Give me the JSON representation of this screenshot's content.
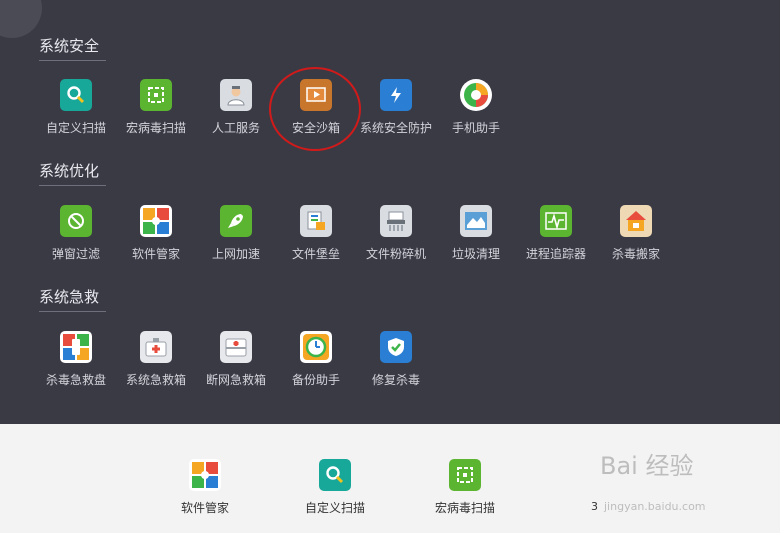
{
  "sections": {
    "security": {
      "title": "系统安全",
      "items": [
        "自定义扫描",
        "宏病毒扫描",
        "人工服务",
        "安全沙箱",
        "系统安全防护",
        "手机助手"
      ]
    },
    "optimize": {
      "title": "系统优化",
      "items": [
        "弹窗过滤",
        "软件管家",
        "上网加速",
        "文件堡垒",
        "文件粉碎机",
        "垃圾清理",
        "进程追踪器",
        "杀毒搬家"
      ]
    },
    "rescue": {
      "title": "系统急救",
      "items": [
        "杀毒急救盘",
        "系统急救箱",
        "断网急救箱",
        "备份助手",
        "修复杀毒"
      ]
    }
  },
  "pinned": [
    "软件管家",
    "自定义扫描",
    "宏病毒扫描"
  ],
  "stray_text": "3",
  "watermark": {
    "main": "Bai 经验",
    "sub": "jingyan.baidu.com"
  },
  "icons": {
    "back": "arrow-left-icon",
    "security": [
      "magnifier-icon",
      "virus-scan-icon",
      "support-agent-icon",
      "sandbox-icon",
      "shield-lightning-icon",
      "mobile-ball-icon"
    ],
    "optimize": [
      "popup-block-icon",
      "app-store-icon",
      "rocket-icon",
      "file-safe-icon",
      "shredder-icon",
      "trash-clean-icon",
      "process-monitor-icon",
      "house-box-icon"
    ],
    "rescue": [
      "usb-rescue-icon",
      "first-aid-kit-icon",
      "network-aid-icon",
      "backup-clock-icon",
      "shield-repair-icon"
    ]
  },
  "colors": {
    "bg_dark": "#3a3a45",
    "bg_light": "#f3f3f3",
    "highlight_circle": "#d11a1a"
  }
}
